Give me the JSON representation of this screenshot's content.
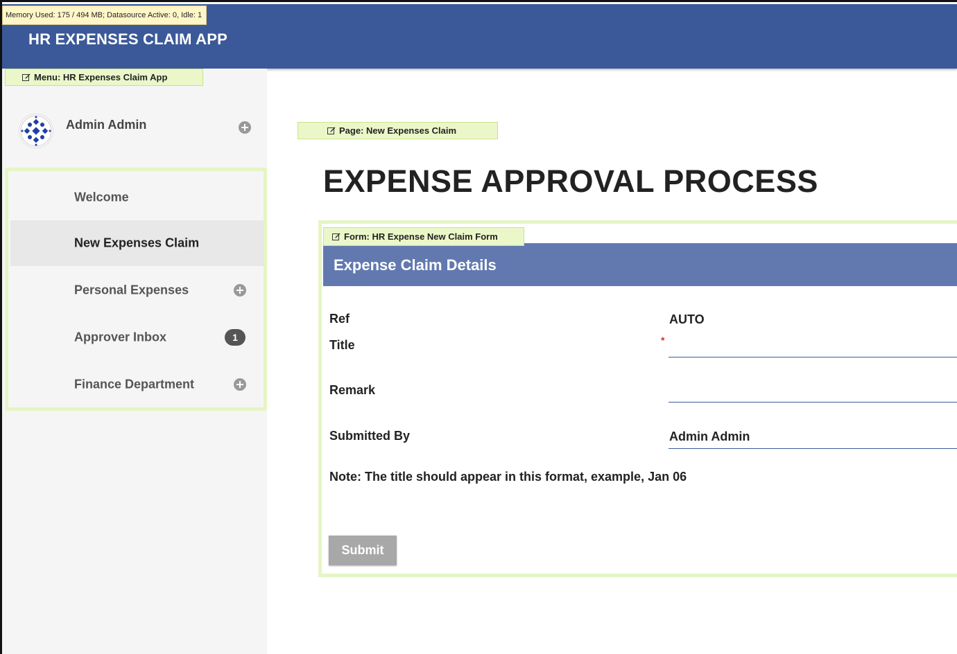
{
  "system": {
    "memory_info": "Memory Used: 175 / 494 MB; Datasource Active: 0, Idle: 1"
  },
  "header": {
    "app_title": "HR EXPENSES CLAIM APP"
  },
  "sidebar": {
    "menu_tag": "Menu: HR Expenses Claim App",
    "user_name": "Admin Admin",
    "items": [
      {
        "label": "Welcome",
        "active": false
      },
      {
        "label": "New Expenses Claim",
        "active": true
      },
      {
        "label": "Personal Expenses",
        "active": false,
        "expandable": true
      },
      {
        "label": "Approver Inbox",
        "active": false,
        "badge": "1"
      },
      {
        "label": "Finance Department",
        "active": false,
        "expandable": true
      }
    ]
  },
  "page": {
    "page_tag": "Page: New Expenses Claim",
    "heading": "EXPENSE APPROVAL PROCESS"
  },
  "form": {
    "form_tag": "Form: HR Expense New Claim Form",
    "section_title": "Expense Claim Details",
    "fields": {
      "ref_label": "Ref",
      "ref_value": "AUTO",
      "title_label": "Title",
      "title_value": "",
      "title_required_mark": "*",
      "remark_label": "Remark",
      "remark_value": "",
      "submitted_by_label": "Submitted By",
      "submitted_by_value": "Admin Admin"
    },
    "note": "Note: The title should appear in this format, example, Jan 06",
    "submit_label": "Submit"
  },
  "colors": {
    "header_bg": "#3b5998",
    "form_header_bg": "#6279b0",
    "builder_tag_bg": "#ebf7c9",
    "builder_border": "#e6f5c4",
    "submit_bg": "#a8a8a8",
    "required": "#d9302c"
  }
}
